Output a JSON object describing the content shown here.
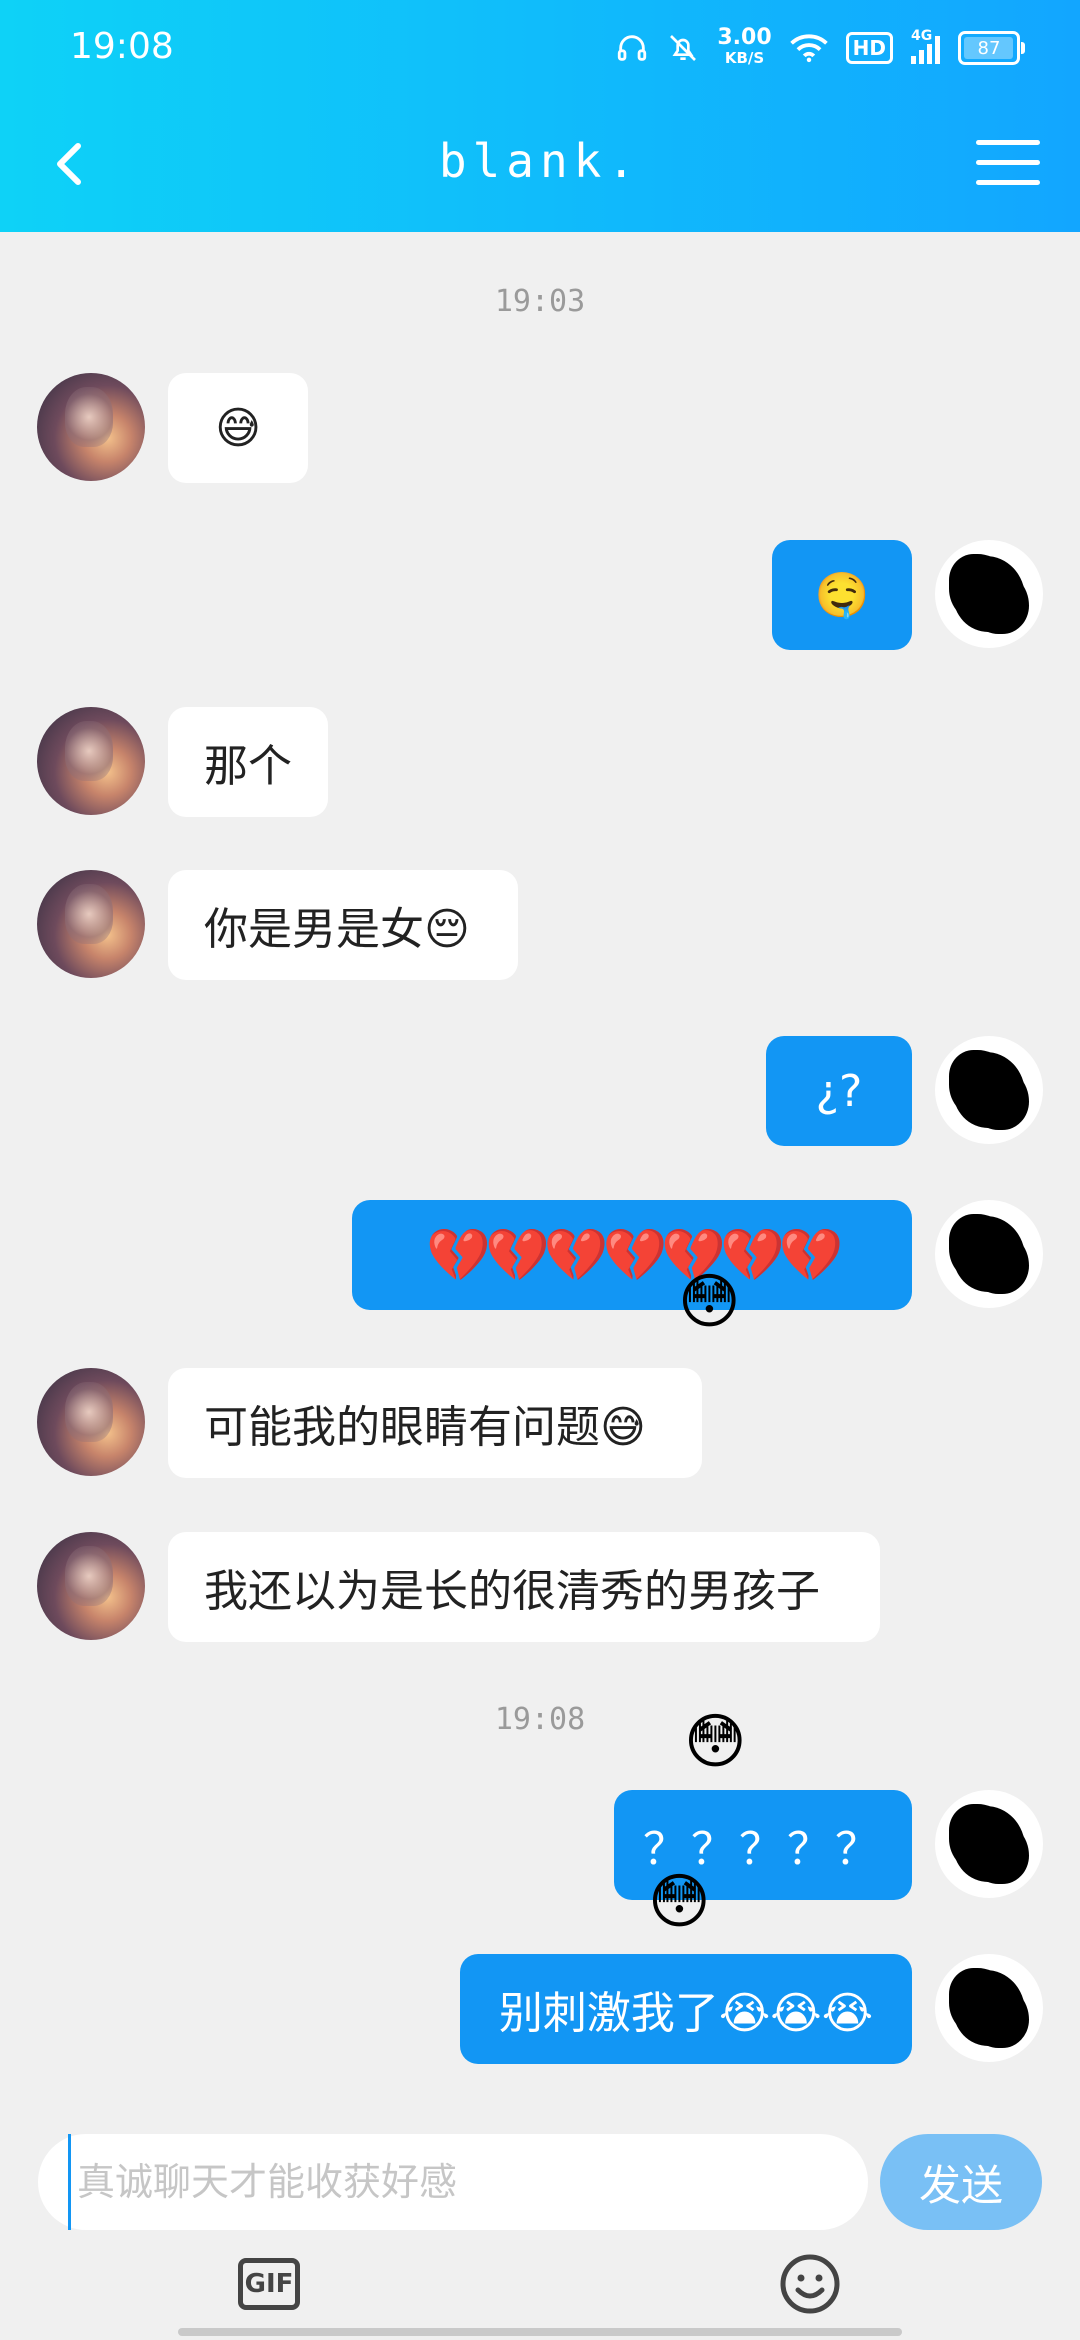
{
  "status_bar": {
    "time": "19:08",
    "speed_value": "3.00",
    "speed_unit": "KB/S",
    "hd": "HD",
    "network": "4G",
    "battery": "87",
    "battery_fraction": 0.87
  },
  "header": {
    "title": "blank.",
    "back_icon": "chevron-left-icon",
    "menu_icon": "hamburger-menu-icon"
  },
  "chat": {
    "timestamps": [
      "19:03",
      "19:08"
    ],
    "messages": [
      {
        "from": "them",
        "text": "😅"
      },
      {
        "from": "me",
        "text": "🤤"
      },
      {
        "from": "them",
        "text": "那个"
      },
      {
        "from": "them",
        "text": "你是男是女😔"
      },
      {
        "from": "me",
        "text": "¿?"
      },
      {
        "from": "me",
        "text": "💔💔💔💔💔💔💔",
        "decoration": "😳"
      },
      {
        "from": "them",
        "text": "可能我的眼睛有问题😅"
      },
      {
        "from": "them",
        "text": "我还以为是长的很清秀的男孩子"
      },
      {
        "from": "me",
        "text": "？？？？？",
        "decoration": "😳"
      },
      {
        "from": "me",
        "text": "别刺激我了😭😭😭",
        "decoration": "😳"
      }
    ]
  },
  "input": {
    "placeholder": "真诚聊天才能收获好感",
    "send_label": "发送",
    "gif_label": "GIF",
    "emoji_icon": "smiley-icon"
  },
  "colors": {
    "header_start": "#0ed2f7",
    "header_end": "#12a6ff",
    "my_bubble": "#1296f4",
    "send_button": "#79c0f5"
  }
}
